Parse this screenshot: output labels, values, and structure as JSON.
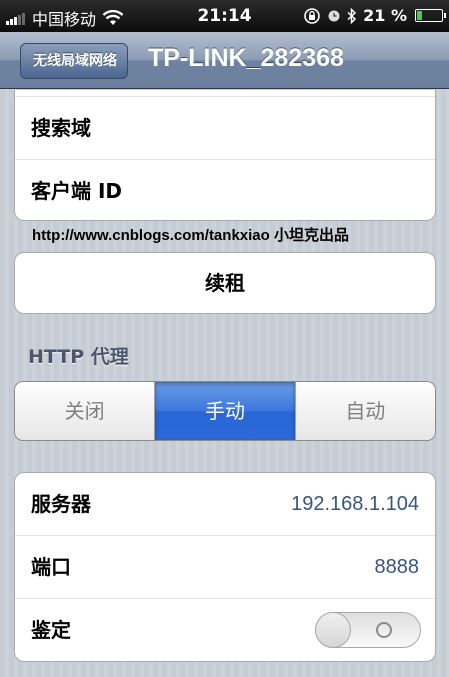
{
  "status_bar": {
    "carrier": "中国移动",
    "time": "21:14",
    "battery": "21 %",
    "battery_level": 0.21
  },
  "nav": {
    "back_label": "无线局域网络",
    "title": "TP-LINK_282368"
  },
  "dhcp_rows": [
    {
      "label": "搜索域"
    },
    {
      "label": "客户端 ID"
    }
  ],
  "watermark": "http://www.cnblogs.com/tankxiao   小坦克出品",
  "renew_label": "续租",
  "proxy": {
    "header": "HTTP 代理",
    "segments": [
      "关闭",
      "手动",
      "自动"
    ],
    "selected": "手动"
  },
  "proxy_rows": [
    {
      "label": "服务器",
      "value": "192.168.1.104"
    },
    {
      "label": "端口",
      "value": "8888"
    },
    {
      "label": "鉴定"
    }
  ],
  "colors": {
    "accent": "#2c6ad8",
    "value_text": "#385487",
    "nav_bar": "#6d83a1"
  }
}
